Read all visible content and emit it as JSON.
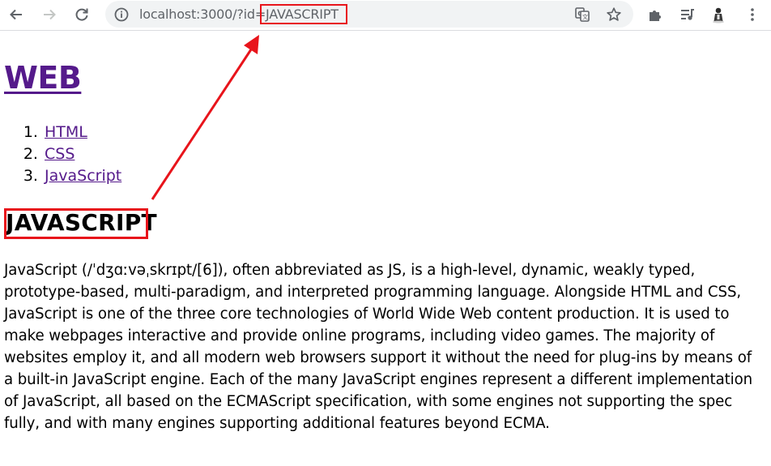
{
  "browser": {
    "url_prefix": "localhost:3000/?id=",
    "url_query": "JAVASCRIPT",
    "icons": [
      "back-icon",
      "forward-icon",
      "reload-icon",
      "info-icon",
      "translate-icon",
      "bookmark-star-icon",
      "extensions-icon",
      "media-control-icon",
      "profile-avatar",
      "menu-kebab-icon"
    ]
  },
  "page": {
    "title": "WEB",
    "nav": [
      {
        "label": "HTML"
      },
      {
        "label": "CSS"
      },
      {
        "label": "JavaScript"
      }
    ],
    "section_title": "JAVASCRIPT",
    "body": "JavaScript (/ˈdʒɑːvəˌskrɪpt/[6]), often abbreviated as JS, is a high-level, dynamic, weakly typed, prototype-based, multi-paradigm, and interpreted programming language. Alongside HTML and CSS, JavaScript is one of the three core technologies of World Wide Web content production. It is used to make webpages interactive and provide online programs, including video games. The majority of websites employ it, and all modern web browsers support it without the need for plug-ins by means of a built-in JavaScript engine. Each of the many JavaScript engines represent a different implementation of JavaScript, all based on the ECMAScript specification, with some engines not supporting the spec fully, and with many engines supporting additional features beyond ECMA."
  },
  "annotation": {
    "color": "#e8141b"
  },
  "colors": {
    "link_visited": "#551a8b",
    "omnibox_bg": "#f1f3f4",
    "toolbar_icon": "#5f6368"
  }
}
